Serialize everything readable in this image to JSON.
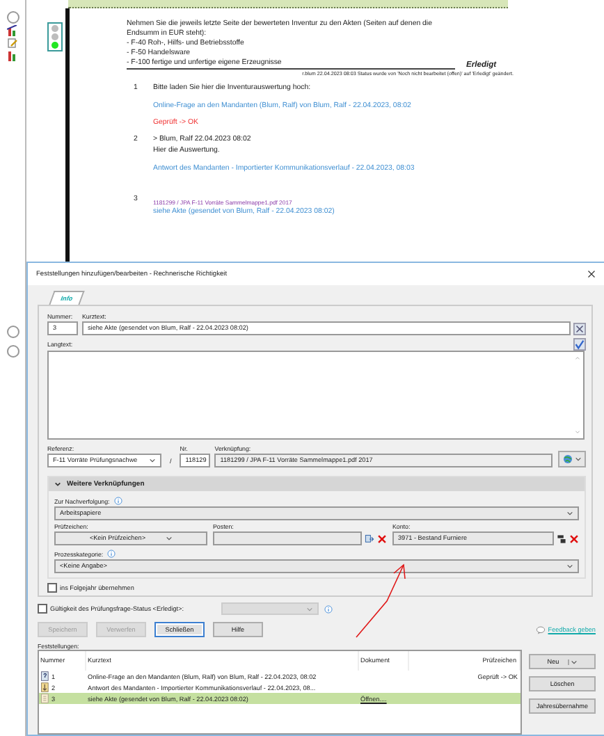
{
  "traffic_light": {
    "lamps": [
      {
        "color": "#bdbdbd"
      },
      {
        "color": "#bdbdbd"
      },
      {
        "color": "#22e622"
      }
    ]
  },
  "question": {
    "lines": [
      "Nehmen Sie die jeweils letzte Seite der bewerteten Inventur zu den Akten (Seiten auf denen die Endsumm in EUR steht):",
      "- F-40 Roh-, Hilfs- und Betriebsstoffe",
      "- F-50 Handelsware",
      "- F-100 fertige und unfertige eigene Erzeugnisse"
    ],
    "status": "Erledigt",
    "status_note": "r.blum 22.04.2023 08:03    Status wurde von 'Noch nicht bearbeitet (offen)' auf 'Erledigt' geändert."
  },
  "entries": [
    {
      "number": "1",
      "text": "Bitte laden Sie hier die Inventurauswertung hoch:",
      "link": "Online-Frage an den Mandanten (Blum, Ralf) von Blum, Ralf - 22.04.2023, 08:02",
      "check": "Geprüft -> OK"
    },
    {
      "number": "2",
      "author": "> Blum, Ralf 22.04.2023 08:02",
      "text": "Hier die Auswertung.",
      "link": "Antwort des Mandanten - Importierter Kommunikationsverlauf - 22.04.2023, 08:03"
    },
    {
      "number": "3",
      "ref": "1181299 / JPA F-11 Vorräte Sammelmappe1.pdf 2017",
      "link": "siehe Akte (gesendet von Blum, Ralf - 22.04.2023 08:02)"
    }
  ],
  "dialog": {
    "title": "Feststellungen hinzufügen/bearbeiten - Rechnerische Richtigkeit",
    "tabs": [
      {
        "label": "Info",
        "selected": true
      }
    ],
    "nummer_label": "Nummer:",
    "nummer": "3",
    "kurztext_label": "Kurztext:",
    "kurztext": "siehe Akte (gesendet von Blum, Ralf - 22.04.2023 08:02)",
    "langtext_label": "Langtext:",
    "referenz_label": "Referenz:",
    "referenz": "F-11 Vorräte Prüfungsnachwe",
    "separator": "/",
    "nr_label": "Nr.",
    "nr": "118129",
    "verknuepfung_label": "Verknüpfung:",
    "verknuepfung": "1181299 / JPA F-11 Vorräte Sammelmappe1.pdf 2017",
    "section": {
      "title": "Weitere Verknüpfungen",
      "expanded": true
    },
    "nachverfolgung_label": "Zur Nachverfolgung:",
    "nachverfolgung": "Arbeitspapiere",
    "pruefzeichen_label": "Prüfzeichen:",
    "pruefzeichen": "<Kein Prüfzeichen>",
    "posten_label": "Posten:",
    "konto_label": "Konto:",
    "konto": "3971 - Bestand Furniere",
    "prozess_label": "Prozesskategorie:",
    "prozess": "<Keine Angabe>",
    "folgejahr": {
      "label": "ins Folgejahr übernehmen",
      "checked": false
    },
    "gueltigkeit": {
      "label": "Gültigkeit des Prüfungsfrage-Status <Erledigt>:",
      "checked": false
    },
    "buttons": [
      {
        "label": "Speichern",
        "disabled": true
      },
      {
        "label": "Verwerfen",
        "disabled": true
      },
      {
        "label": "Schließen",
        "disabled": false
      },
      {
        "label": "Hilfe",
        "disabled": false
      }
    ],
    "feedback": "Feedback geben",
    "list_label": "Feststellungen:",
    "columns": [
      "Nummer",
      "Kurztext",
      "Dokument",
      "Prüfzeichen"
    ],
    "rows": [
      {
        "kind": "question",
        "number": "1",
        "kurztext": "Online-Frage an den Mandanten (Blum, Ralf) von Blum, Ralf - 22.04.2023, 08:02",
        "dokument": "",
        "pruefzeichen": "Geprüft -> OK",
        "selected": false
      },
      {
        "kind": "answer",
        "number": "2",
        "kurztext": "Antwort des Mandanten - Importierter Kommunikationsverlauf - 22.04.2023, 08...",
        "dokument": "",
        "pruefzeichen": "",
        "selected": false
      },
      {
        "kind": "document",
        "number": "3",
        "kurztext": "siehe Akte (gesendet von Blum, Ralf - 22.04.2023 08:02)",
        "dokument": "Öffnen....",
        "pruefzeichen": "",
        "selected": true
      }
    ],
    "side_buttons": [
      "Neu",
      "Löschen",
      "Jahresübernahme"
    ]
  }
}
